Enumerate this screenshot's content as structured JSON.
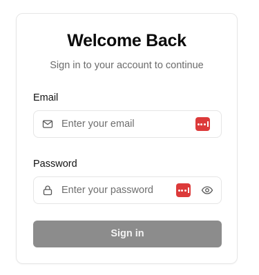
{
  "card": {
    "title": "Welcome Back",
    "subtitle": "Sign in to your account to continue"
  },
  "email": {
    "label": "Email",
    "placeholder": "Enter your email",
    "value": "",
    "icon": "mail-icon",
    "password_manager_icon": "password-manager-icon"
  },
  "password": {
    "label": "Password",
    "placeholder": "Enter your password",
    "value": "",
    "icon": "lock-icon",
    "password_manager_icon": "password-manager-icon",
    "toggle_icon": "eye-icon"
  },
  "submit": {
    "label": "Sign in",
    "color": "#8c8c8c",
    "disabled": true
  },
  "colors": {
    "password_manager": "#dc3a3a",
    "border": "#e5e5e5",
    "muted_text": "#6b6b6b"
  }
}
